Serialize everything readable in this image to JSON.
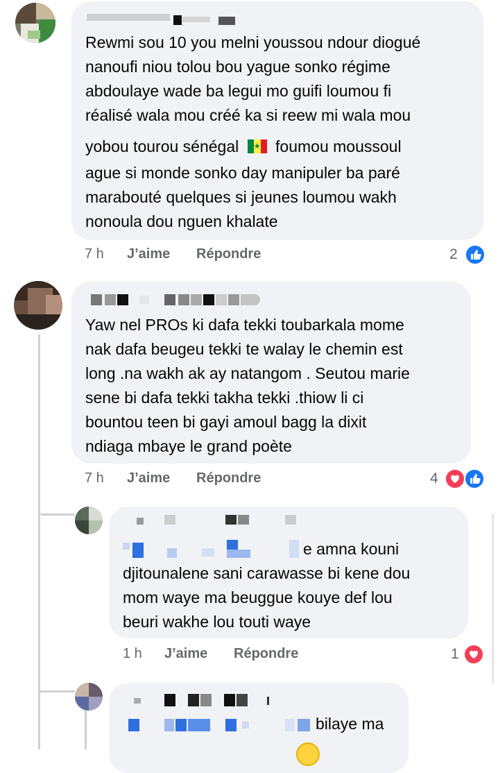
{
  "comments": [
    {
      "text_lines": [
        "Rewmi sou 10 you melni youssou ndour diogué",
        "nanoufi niou tolou bou yague sonko régime",
        "abdoulaye wade ba legui mo guifi loumou fi",
        "réalisé wala mou créé ka si reew mi wala mou"
      ],
      "flag_line_before": "yobou tourou sénégal",
      "flag_emoji": "🇸🇳",
      "flag_line_after": "foumou moussoul",
      "text_lines_2": [
        "ague si monde sonko day manipuler ba paré",
        "marabouté quelques si jeunes loumou wakh",
        "nonoula dou nguen khalate"
      ],
      "time": "7 h",
      "like_label": "J’aime",
      "reply_label": "Répondre",
      "reaction_count": "2",
      "reactions": [
        "like-icon"
      ]
    },
    {
      "text_lines": [
        "Yaw nel PROs ki dafa tekki toubarkala  mome",
        "nak dafa beugeu tekki te walay  le chemin est",
        "long .na wakh ak ay natangom . Seutou marie",
        "sene bi dafa tekki takha tekki  .thiow li ci",
        "bountou teen bi gayi amoul bagg la dixit",
        "ndiaga mbaye  le grand  poète"
      ],
      "time": "7 h",
      "like_label": "J’aime",
      "reply_label": "Répondre",
      "reaction_count": "4",
      "reactions": [
        "love-icon",
        "like-icon"
      ]
    },
    {
      "first_line_suffix": "e amna kouni",
      "text_lines": [
        "djitounalene sani carawasse bi kene dou",
        "mom waye ma beuggue kouye def lou",
        "beuri wakhe lou touti waye"
      ],
      "time": "1 h",
      "like_label": "J’aime",
      "reply_label": "Répondre",
      "reaction_count": "1",
      "reactions": [
        "love-icon"
      ]
    },
    {
      "first_line_suffix": "bilaye ma"
    }
  ],
  "colors": {
    "bubble": "#f0f2f5",
    "meta_text": "#65676b",
    "like_blue": "#1877f2",
    "love_red": "#f33e58",
    "thread_line": "#ced0d4"
  }
}
